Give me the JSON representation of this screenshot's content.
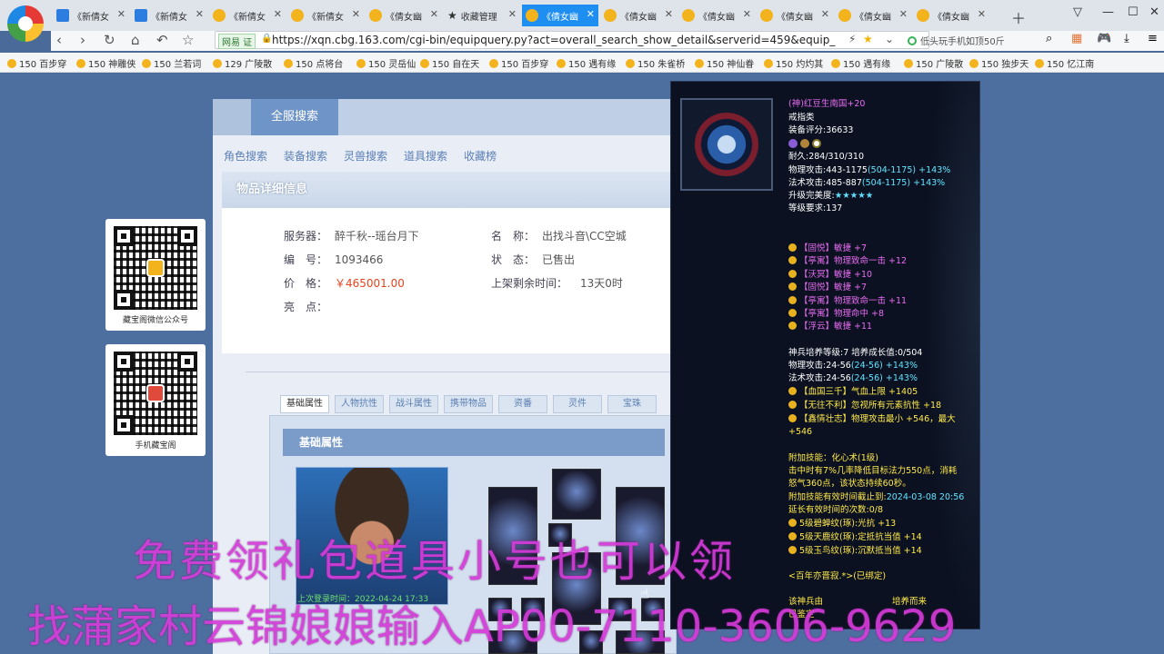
{
  "browser": {
    "tabs": [
      {
        "label": "《新倩女",
        "icon": "blue"
      },
      {
        "label": "《新倩女",
        "icon": "blue"
      },
      {
        "label": "《新倩女",
        "icon": "yellow"
      },
      {
        "label": "《新倩女",
        "icon": "yellow"
      },
      {
        "label": "《倩女幽",
        "icon": "yellow"
      },
      {
        "label": "收藏管理",
        "icon": "star"
      },
      {
        "label": "《倩女幽",
        "icon": "yellow",
        "active": true
      },
      {
        "label": "《倩女幽",
        "icon": "yellow"
      },
      {
        "label": "《倩女幽",
        "icon": "yellow"
      },
      {
        "label": "《倩女幽",
        "icon": "yellow"
      },
      {
        "label": "《倩女幽",
        "icon": "yellow"
      },
      {
        "label": "《倩女幽",
        "icon": "yellow"
      }
    ],
    "url_badge": "网易 证",
    "url": "https://xqn.cbg.163.com/cgi-bin/equipquery.py?act=overall_search_show_detail&serverid=459&equip_id",
    "ext_search": "低头玩手机如顶50斤",
    "bookmarks": [
      "150 百步穿",
      "150 神雕侠",
      "150 兰若词",
      "129 广陵散",
      "150 点将台",
      "150 灵岳仙",
      "150 自在天",
      "150 百步穿",
      "150 遇有缘",
      "150 朱雀桥",
      "150 神仙眷",
      "150 灼灼其",
      "150 遇有缘",
      "150 广陵散",
      "150 独步天",
      "150 忆江南"
    ]
  },
  "sidebar": {
    "qr1_caption": "藏宝阁微信公众号",
    "qr2_caption": "手机藏宝阁"
  },
  "panel": {
    "tab_active": "全服搜索",
    "subnav": [
      "角色搜索",
      "装备搜索",
      "灵兽搜索",
      "道具搜索",
      "收藏榜"
    ],
    "detail_title": "物品详细信息",
    "info": {
      "server_label": "服务器：",
      "server_value": "醉千秋--瑶台月下",
      "name_label": "名　称：",
      "name_value": "出找斗音\\CC空城",
      "id_label": "编　号：",
      "id_value": "1093466",
      "status_label": "状　态：",
      "status_value": "已售出",
      "price_label": "价　格：",
      "price_value": "￥465001.00",
      "time_label": "上架剩余时间：",
      "time_value": "13天0时",
      "highlight_label": "亮　点："
    },
    "attr_tabs": [
      "基础属性",
      "人物抗性",
      "战斗属性",
      "携带物品",
      "资番",
      "灵件",
      "宝珠"
    ],
    "attr_header": "基础属性",
    "portrait_caption": "上次登录时间：2022-04-24 17:33"
  },
  "tooltip": {
    "name": "(神)红豆生南国+20",
    "category": "戒指类",
    "score": "装备评分:36633",
    "durability": "耐久:284/310/310",
    "phys_atk": "物理攻击:443-1175",
    "phys_atk_range": "(504-1175)",
    "phys_atk_pct": "+143%",
    "mag_atk": "法术攻击:485-887",
    "mag_atk_range": "(504-1175)",
    "mag_atk_pct": "+143%",
    "upgrade_label": "升级完美度:",
    "upgrade_stars": "★★★★★",
    "level_req": "等级要求:137",
    "affixes": [
      "【固悦】敏捷 +7",
      "【亭寓】物理致命一击 +12",
      "【沃冥】敏捷 +10",
      "【固悦】敏捷 +7",
      "【亭寓】物理致命一击 +11",
      "【亭寓】物理命中 +8",
      "【浮云】敏捷 +11"
    ],
    "divine_level": "神兵培养等级:7 培养成长值:0/504",
    "divine_phys": "物理攻击:24-56",
    "divine_phys_range": "(24-56)",
    "divine_phys_pct": "+143%",
    "divine_mag": "法术攻击:24-56",
    "divine_mag_range": "(24-56)",
    "divine_mag_pct": "+143%",
    "divine_skills": [
      "【血国三千】气血上限 +1405",
      "【无往不利】忽视所有元素抗性 +18",
      "【鑫情壮志】物理攻击最小 +546，最大"
    ],
    "divine_tail": "+546",
    "addon_skill": "附加技能：化心术(1级)",
    "addon_desc1": "击中时有7%几率降低目标法力550点，消耗",
    "addon_desc2": "怒气360点，该状态持续60秒。",
    "addon_expire_label": "附加技能有效时间截止到:",
    "addon_expire": "2024-03-08 20:56",
    "extend": "延长有效时间的次数:0/8",
    "stones": [
      "5级碧蝉纹(琢):光抗 +13",
      "5级天鹿纹(琢):定抵抗当值 +14",
      "5级玉鸟纹(琢):沉默抵当值 +14"
    ],
    "bind": "<百年亦晋寂.*>(已绑定)",
    "source_prefix": "该神兵由",
    "source_suffix": "培养而来",
    "appraised": "已鉴定"
  },
  "overlay": {
    "line1": "免费领礼包道具小号也可以领",
    "line2": "找蒲家村云锦娘娘输入AP00-7110-3606-9629"
  }
}
